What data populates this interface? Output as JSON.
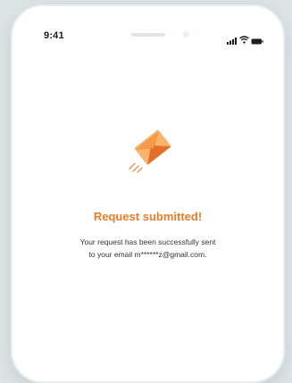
{
  "status_bar": {
    "time": "9:41",
    "icons": [
      "signal-icon",
      "wifi-icon",
      "battery-icon"
    ]
  },
  "confirmation": {
    "icon": "envelope-send-icon",
    "title": "Request submitted!",
    "message_line1": "Your request has been successfully sent",
    "message_line2": "to your email m******z@gmail.com."
  },
  "colors": {
    "accent": "#ec7c25",
    "envelope_light": "#f8b46a",
    "envelope_dark": "#e2702a",
    "background": "#dde4e6",
    "screen": "#ffffff"
  }
}
